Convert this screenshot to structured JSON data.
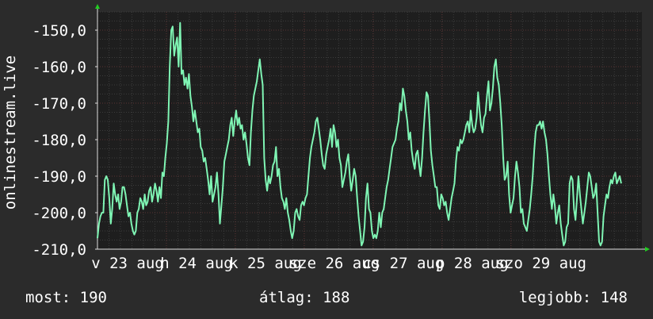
{
  "colors": {
    "background": "#2b2b2b",
    "plot_background": "#1e1e1e",
    "grid_major": "#5a3232",
    "grid_minor": "#3c3c3c",
    "line": "#7ff5b4",
    "text": "#ffffff",
    "axis_arrow": "#22cc22"
  },
  "chart_data": {
    "type": "line",
    "ylabel": "onlinestream.live",
    "ylim": [
      -210,
      -145
    ],
    "y_ticks": [
      -150,
      -160,
      -170,
      -180,
      -190,
      -200,
      -210
    ],
    "y_tick_labels": [
      "-150,0",
      "-160,0",
      "-170,0",
      "-180,0",
      "-190,0",
      "-200,0",
      "-210,0"
    ],
    "x_range": [
      0,
      7.9
    ],
    "x_ticks": [
      {
        "pos": 0.0,
        "label": "v 23 aug"
      },
      {
        "pos": 1.0,
        "label": "h 24 aug"
      },
      {
        "pos": 2.0,
        "label": "k 25 aug"
      },
      {
        "pos": 3.0,
        "label": "sze 26 aug"
      },
      {
        "pos": 4.0,
        "label": "cs 27 aug"
      },
      {
        "pos": 5.0,
        "label": "p 28 aug"
      },
      {
        "pos": 6.0,
        "label": "szo 29 aug"
      }
    ],
    "grid": true,
    "series": [
      {
        "values": [
          -207,
          -203,
          -201,
          -200,
          -200,
          -191,
          -190,
          -191,
          -196,
          -203,
          -199,
          -192,
          -195,
          -197,
          -195,
          -199,
          -197,
          -193,
          -193,
          -195,
          -198,
          -201,
          -200,
          -203,
          -205,
          -206,
          -205,
          -200,
          -199,
          -196,
          -197,
          -199,
          -195,
          -198,
          -197,
          -194,
          -193,
          -197,
          -195,
          -192,
          -194,
          -197,
          -193,
          -196,
          -189,
          -190,
          -185,
          -181,
          -175,
          -160,
          -150,
          -149,
          -157,
          -154,
          -152,
          -160,
          -148,
          -162,
          -161,
          -165,
          -163,
          -166,
          -162,
          -168,
          -171,
          -175,
          -172,
          -175,
          -178,
          -177,
          -182,
          -183,
          -186,
          -185,
          -188,
          -191,
          -195,
          -190,
          -197,
          -195,
          -193,
          -189,
          -195,
          -203,
          -198,
          -193,
          -186,
          -184,
          -182,
          -180,
          -176,
          -174,
          -179,
          -175,
          -172,
          -176,
          -174,
          -177,
          -176,
          -180,
          -178,
          -181,
          -185,
          -187,
          -178,
          -172,
          -168,
          -166,
          -164,
          -161,
          -158,
          -162,
          -165,
          -185,
          -191,
          -194,
          -190,
          -192,
          -190,
          -187,
          -186,
          -182,
          -190,
          -188,
          -193,
          -196,
          -197,
          -199,
          -196,
          -200,
          -202,
          -205,
          -207,
          -205,
          -200,
          -199,
          -201,
          -202,
          -198,
          -197,
          -198,
          -196,
          -195,
          -190,
          -185,
          -182,
          -180,
          -178,
          -175,
          -174,
          -177,
          -180,
          -184,
          -187,
          -188,
          -184,
          -182,
          -180,
          -177,
          -182,
          -176,
          -178,
          -182,
          -180,
          -185,
          -187,
          -193,
          -191,
          -189,
          -186,
          -184,
          -190,
          -194,
          -191,
          -188,
          -190,
          -196,
          -201,
          -205,
          -209,
          -208,
          -204,
          -196,
          -192,
          -199,
          -200,
          -205,
          -207,
          -206,
          -207,
          -205,
          -200,
          -204,
          -200,
          -199,
          -196,
          -193,
          -191,
          -188,
          -185,
          -182,
          -181,
          -180,
          -177,
          -175,
          -170,
          -172,
          -166,
          -168,
          -172,
          -175,
          -180,
          -178,
          -183,
          -186,
          -188,
          -184,
          -183,
          -187,
          -190,
          -185,
          -178,
          -172,
          -167,
          -168,
          -175,
          -183,
          -187,
          -190,
          -193,
          -193,
          -198,
          -199,
          -195,
          -196,
          -198,
          -197,
          -200,
          -202,
          -199,
          -196,
          -194,
          -192,
          -186,
          -182,
          -183,
          -180,
          -181,
          -180,
          -178,
          -176,
          -175,
          -178,
          -172,
          -176,
          -178,
          -177,
          -174,
          -167,
          -172,
          -176,
          -178,
          -174,
          -173,
          -168,
          -164,
          -172,
          -170,
          -166,
          -160,
          -158,
          -163,
          -165,
          -170,
          -176,
          -185,
          -191,
          -190,
          -186,
          -195,
          -200,
          -198,
          -196,
          -190,
          -186,
          -189,
          -193,
          -200,
          -199,
          -203,
          -204,
          -205,
          -202,
          -199,
          -195,
          -190,
          -183,
          -178,
          -176,
          -176,
          -175,
          -177,
          -175,
          -178,
          -180,
          -184,
          -190,
          -195,
          -199,
          -195,
          -198,
          -203,
          -200,
          -198,
          -203,
          -206,
          -209,
          -208,
          -204,
          -203,
          -192,
          -190,
          -191,
          -199,
          -202,
          -196,
          -190,
          -195,
          -199,
          -203,
          -200,
          -197,
          -193,
          -189,
          -190,
          -193,
          -196,
          -195,
          -192,
          -200,
          -208,
          -209,
          -208,
          -201,
          -198,
          -195,
          -196,
          -193,
          -191,
          -192,
          -190,
          -189,
          -192,
          -191,
          -190,
          -192
        ],
        "x_end": 7.6
      }
    ]
  },
  "legend": {
    "now_label": "most: 190",
    "avg_label": "átlag: 188",
    "best_label": "legjobb: 148"
  }
}
